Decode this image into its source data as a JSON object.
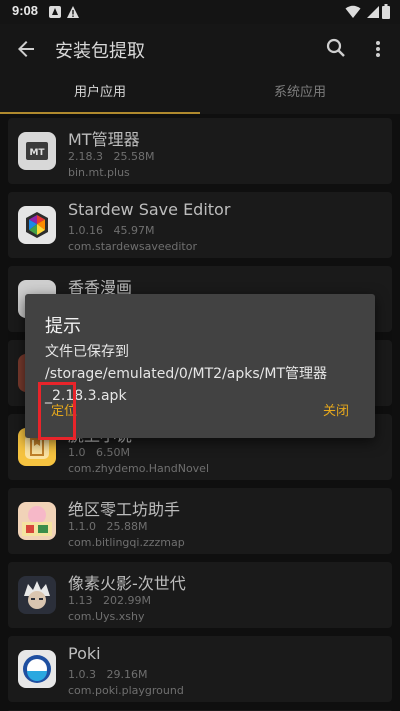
{
  "status_bar": {
    "time": "9:08"
  },
  "app_bar": {
    "title": "安装包提取"
  },
  "tabs": [
    {
      "label": "用户应用",
      "active": true
    },
    {
      "label": "系统应用",
      "active": false
    }
  ],
  "apps": [
    {
      "name": "MT管理器",
      "version": "2.18.3",
      "size": "25.58M",
      "package": "bin.mt.plus"
    },
    {
      "name": "Stardew Save Editor",
      "version": "1.0.16",
      "size": "45.97M",
      "package": "com.stardewsaveeditor"
    },
    {
      "name": "香香漫画",
      "version": "",
      "size": "",
      "package": ""
    },
    {
      "name": "",
      "version": "",
      "size": "",
      "package": ""
    },
    {
      "name": "腕上小说",
      "version": "1.0",
      "size": "6.50M",
      "package": "com.zhydemo.HandNovel"
    },
    {
      "name": "绝区零工坊助手",
      "version": "1.1.0",
      "size": "25.88M",
      "package": "com.bitlingqi.zzzmap"
    },
    {
      "name": "像素火影-次世代",
      "version": "1.13",
      "size": "202.99M",
      "package": "com.Uys.xshy"
    },
    {
      "name": "Poki",
      "version": "1.0.3",
      "size": "29.16M",
      "package": "com.poki.playground"
    }
  ],
  "dialog": {
    "title": "提示",
    "message": "文件已保存到 /storage/emulated/0/MT2/apks/MT管理器_2.18.3.apk",
    "locate_label": "定位",
    "close_label": "关闭"
  },
  "colors": {
    "accent": "#e6a81c",
    "highlight": "#e8242a",
    "tab_indicator": "#b08a2e"
  },
  "icons": [
    "android-icon",
    "warning-icon",
    "wifi-icon",
    "battery-icon",
    "back-arrow-icon",
    "search-icon",
    "more-vert-icon"
  ]
}
